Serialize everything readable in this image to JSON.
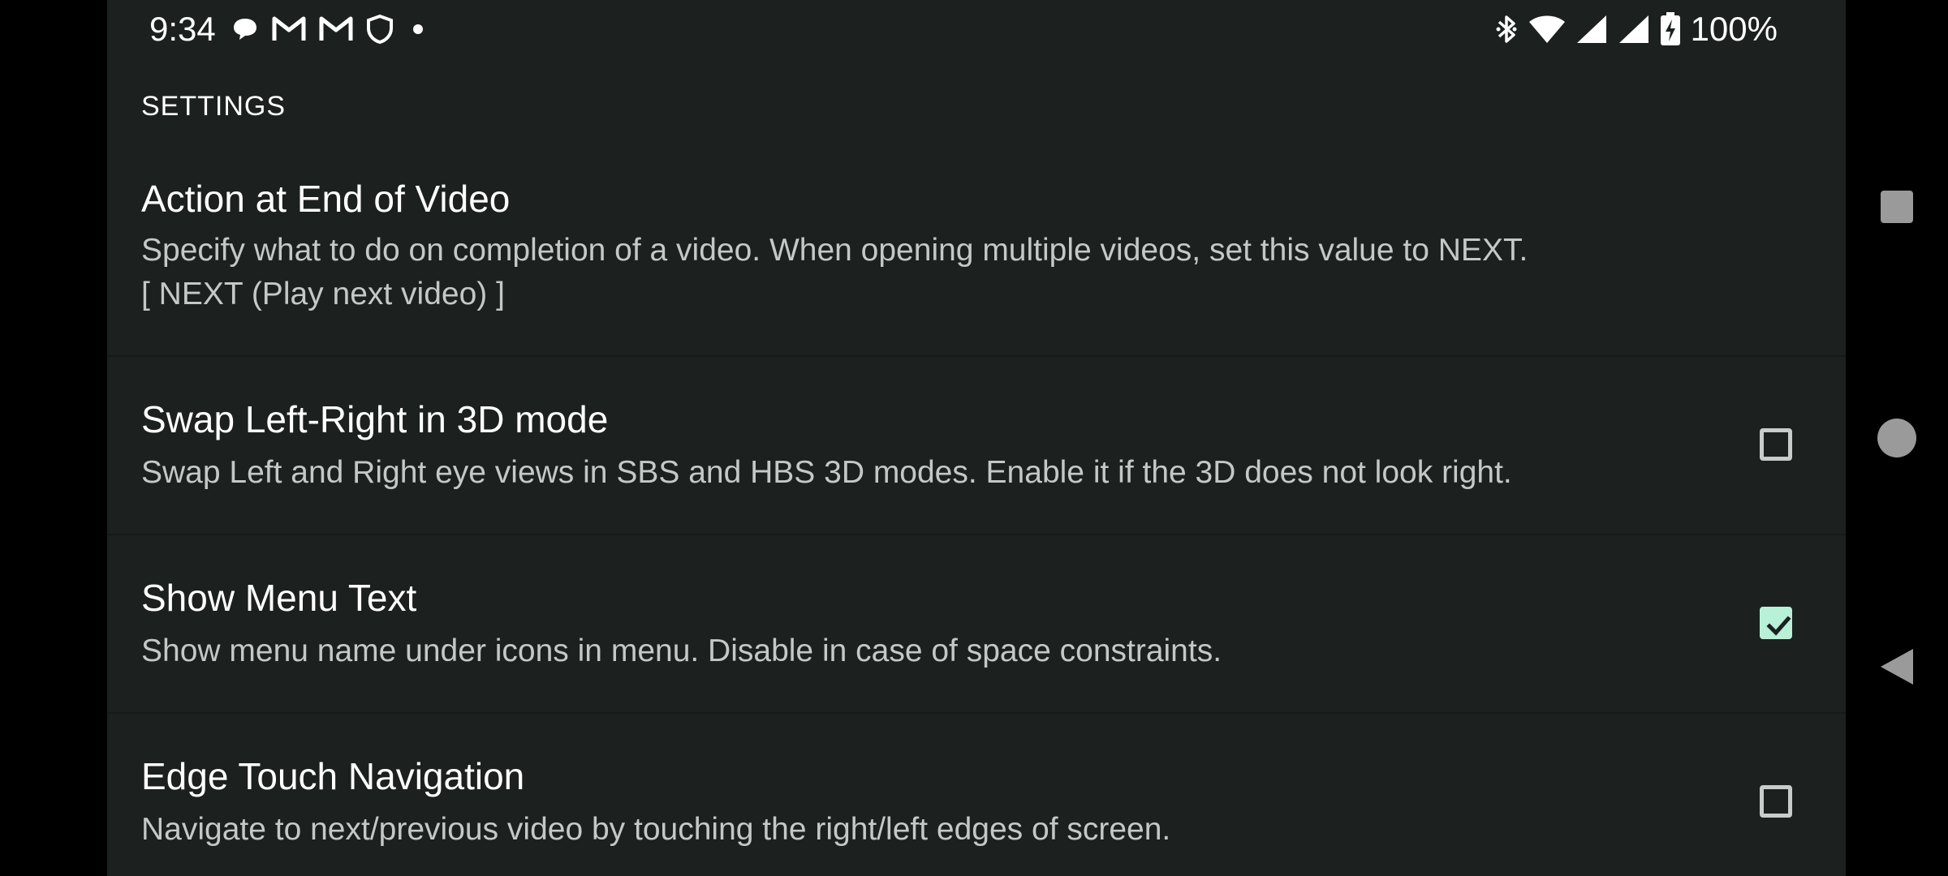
{
  "status_bar": {
    "time": "9:34",
    "left_icons": [
      "chat-bubble-icon",
      "gmail-icon",
      "gmail-icon",
      "shield-icon",
      "dot-icon"
    ],
    "right_icons": [
      "bluetooth-icon",
      "wifi-icon",
      "signal-icon",
      "signal-icon",
      "battery-charging-icon"
    ],
    "battery": "100%"
  },
  "header": {
    "title": "SETTINGS"
  },
  "preferences": [
    {
      "title": "Action at End of Video",
      "summary": "Specify what to do on completion of a video. When opening multiple videos, set this value to NEXT.",
      "value": "[ NEXT (Play next video) ]"
    },
    {
      "title": "Swap Left-Right in 3D mode",
      "summary": "Swap Left and Right eye views in SBS and HBS 3D modes. Enable it if the 3D does not look right.",
      "checked": false
    },
    {
      "title": "Show Menu Text",
      "summary": "Show menu name under icons in menu. Disable in case of space constraints.",
      "checked": true
    },
    {
      "title": "Edge Touch Navigation",
      "summary": "Navigate to next/previous video by touching the right/left edges of screen.",
      "checked": false
    }
  ],
  "nav_bar": {
    "buttons": [
      "recents-button",
      "home-button",
      "back-button"
    ]
  },
  "colors": {
    "background": "#1c201f",
    "checkbox_checked": "#b8f0d8",
    "text_primary": "#ffffff",
    "text_secondary": "#c4c8c6"
  }
}
